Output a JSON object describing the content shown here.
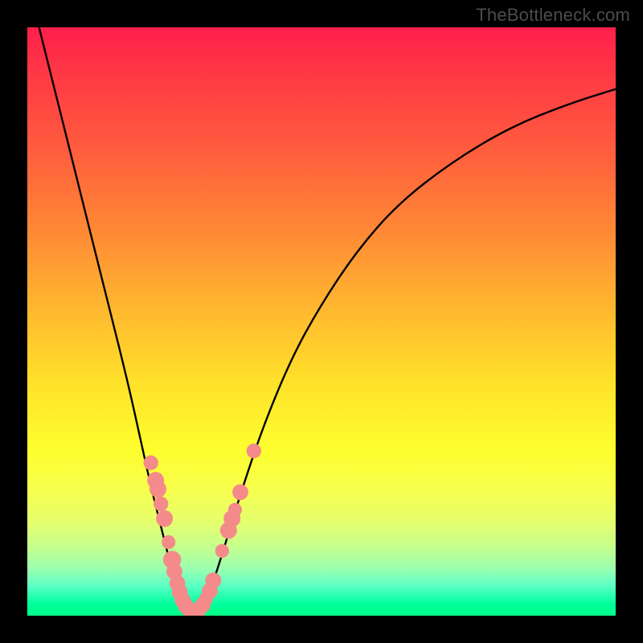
{
  "watermark": "TheBottleneck.com",
  "chart_data": {
    "type": "line",
    "title": "",
    "xlabel": "",
    "ylabel": "",
    "xlim": [
      0,
      100
    ],
    "ylim": [
      0,
      100
    ],
    "series": [
      {
        "name": "bottleneck-curve",
        "x": [
          2,
          5,
          8,
          11,
          14,
          17,
          19,
          21,
          23,
          24.5,
          26,
          27,
          28,
          29.5,
          31,
          33,
          36,
          40,
          45,
          50,
          56,
          63,
          72,
          82,
          92,
          100
        ],
        "values": [
          100,
          88,
          76,
          64,
          52,
          40,
          31,
          22,
          14,
          8,
          3.5,
          1.4,
          0.6,
          1.4,
          4,
          10,
          20,
          32,
          44,
          53,
          62,
          70,
          77,
          83,
          87,
          89.5
        ]
      }
    ],
    "markers": {
      "name": "sample-dots",
      "color": "#f48a8a",
      "points": [
        {
          "x": 21.0,
          "y": 26.0,
          "r": 1.4
        },
        {
          "x": 21.8,
          "y": 23.0,
          "r": 1.6
        },
        {
          "x": 22.2,
          "y": 21.5,
          "r": 1.6
        },
        {
          "x": 22.7,
          "y": 19.0,
          "r": 1.4
        },
        {
          "x": 23.3,
          "y": 16.5,
          "r": 1.6
        },
        {
          "x": 24.0,
          "y": 12.5,
          "r": 1.3
        },
        {
          "x": 24.6,
          "y": 9.5,
          "r": 1.7
        },
        {
          "x": 25.0,
          "y": 7.5,
          "r": 1.5
        },
        {
          "x": 25.5,
          "y": 5.5,
          "r": 1.5
        },
        {
          "x": 25.9,
          "y": 4.0,
          "r": 1.5
        },
        {
          "x": 26.4,
          "y": 2.6,
          "r": 1.5
        },
        {
          "x": 27.0,
          "y": 1.6,
          "r": 1.5
        },
        {
          "x": 27.7,
          "y": 0.8,
          "r": 1.5
        },
        {
          "x": 28.3,
          "y": 0.6,
          "r": 1.5
        },
        {
          "x": 29.0,
          "y": 0.9,
          "r": 1.5
        },
        {
          "x": 29.8,
          "y": 1.8,
          "r": 1.5
        },
        {
          "x": 30.4,
          "y": 2.9,
          "r": 1.3
        },
        {
          "x": 31.0,
          "y": 4.2,
          "r": 1.5
        },
        {
          "x": 31.6,
          "y": 6.0,
          "r": 1.5
        },
        {
          "x": 33.1,
          "y": 11.0,
          "r": 1.3
        },
        {
          "x": 34.2,
          "y": 14.5,
          "r": 1.6
        },
        {
          "x": 34.8,
          "y": 16.5,
          "r": 1.6
        },
        {
          "x": 35.3,
          "y": 18.0,
          "r": 1.3
        },
        {
          "x": 36.2,
          "y": 21.0,
          "r": 1.5
        },
        {
          "x": 38.5,
          "y": 28.0,
          "r": 1.4
        }
      ]
    }
  }
}
